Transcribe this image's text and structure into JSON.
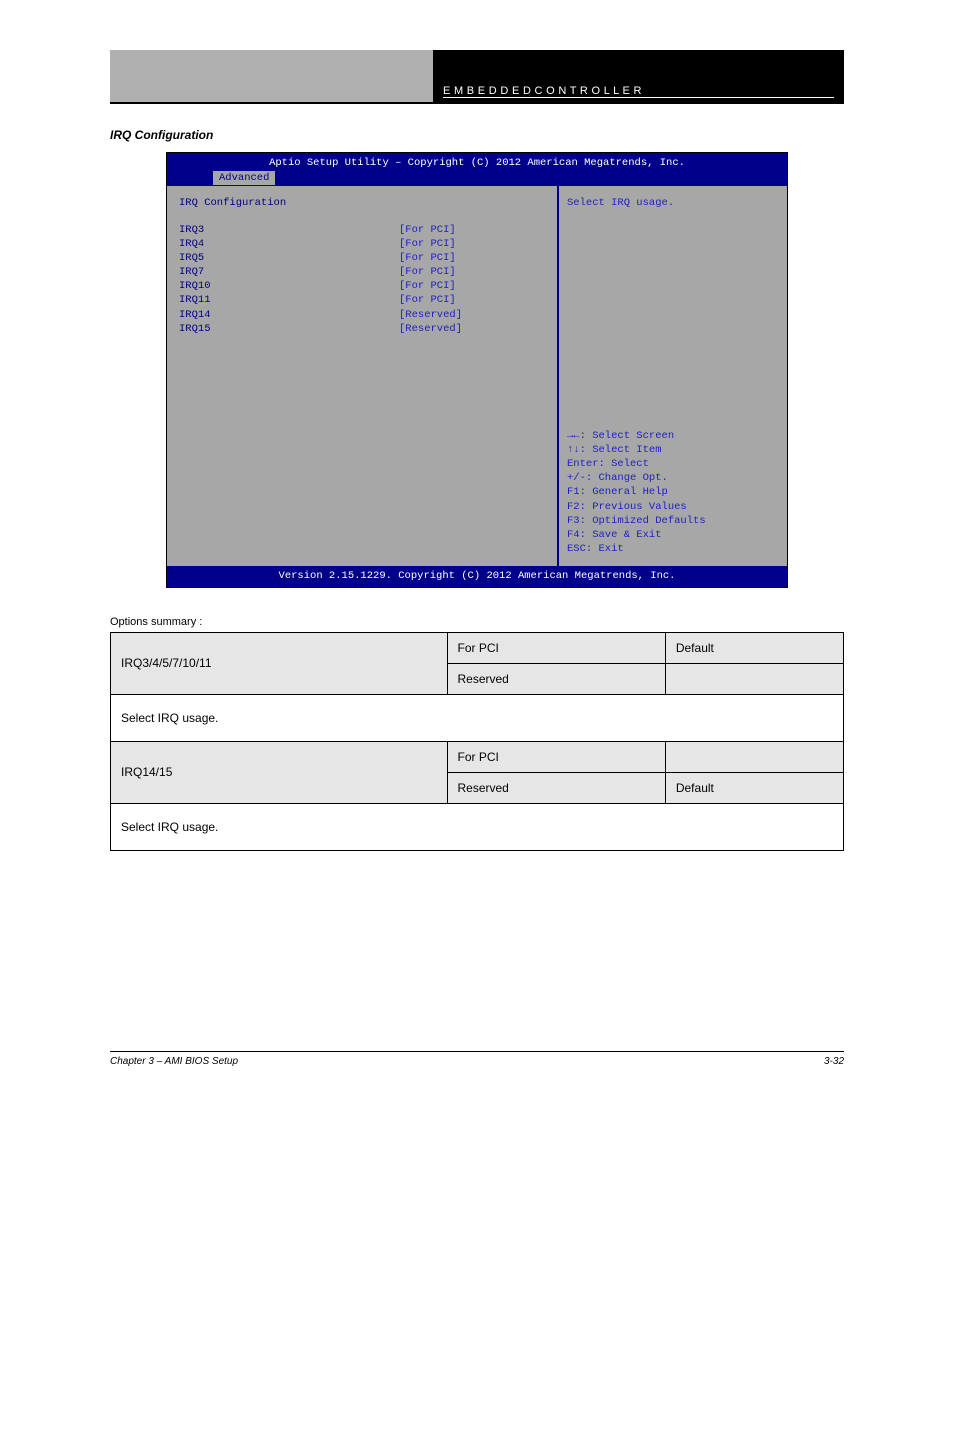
{
  "header": {
    "right_text": "E M B E D D E D   C O N T R O L L E R"
  },
  "section": {
    "heading": "IRQ Configuration"
  },
  "bios": {
    "title": "Aptio Setup Utility – Copyright (C) 2012 American Megatrends, Inc.",
    "tab": "Advanced",
    "panel_title": "IRQ Configuration",
    "rows": [
      {
        "k": "IRQ3",
        "v": "[For PCI]"
      },
      {
        "k": "IRQ4",
        "v": "[For PCI]"
      },
      {
        "k": "IRQ5",
        "v": "[For PCI]"
      },
      {
        "k": "IRQ7",
        "v": "[For PCI]"
      },
      {
        "k": "IRQ10",
        "v": "[For PCI]"
      },
      {
        "k": "IRQ11",
        "v": "[For PCI]"
      },
      {
        "k": "IRQ14",
        "v": "[Reserved]"
      },
      {
        "k": "IRQ15",
        "v": "[Reserved]"
      }
    ],
    "help": "Select IRQ usage.",
    "keys": [
      "→←: Select Screen",
      "↑↓: Select Item",
      "Enter: Select",
      "+/-: Change Opt.",
      "F1: General Help",
      "F2: Previous Values",
      "F3: Optimized Defaults",
      "F4: Save & Exit",
      "ESC: Exit"
    ],
    "footer": "Version 2.15.1229. Copyright (C) 2012 American Megatrends, Inc."
  },
  "opts_label": "Options summary :",
  "table": {
    "row1": {
      "label": "IRQ3/4/5/7/10/11",
      "opt_a": "For PCI",
      "def_a": "Default",
      "opt_b": "Reserved",
      "def_b": ""
    },
    "desc1": "Select IRQ usage.",
    "row2": {
      "label": "IRQ14/15",
      "opt_a": "For PCI",
      "def_a": "",
      "opt_b": "Reserved",
      "def_b": "Default"
    },
    "desc2": "Select IRQ usage."
  },
  "footer": {
    "left": "Chapter 3 – AMI BIOS Setup",
    "right": "3-32"
  }
}
